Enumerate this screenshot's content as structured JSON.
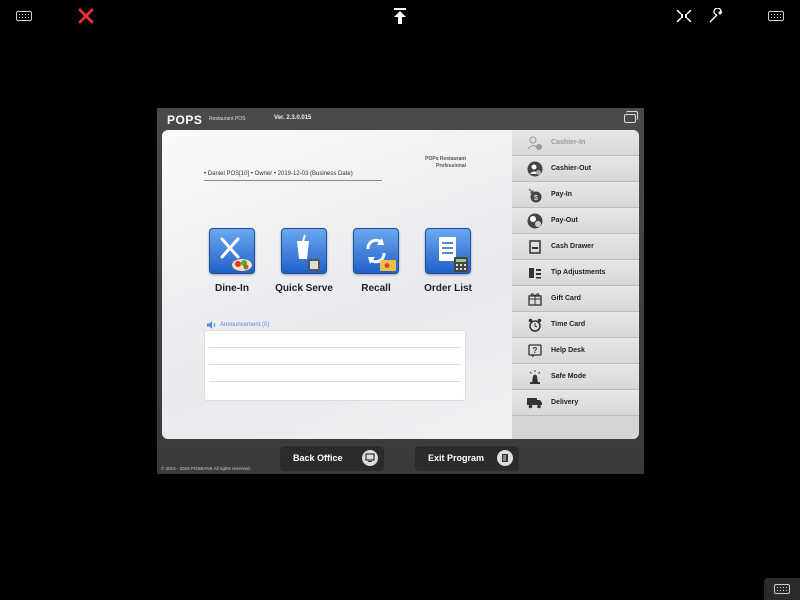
{
  "app": {
    "logo": "POPS",
    "logo_sub": "Restaurant POS",
    "version": "Ver. 2.3.0.015",
    "brand_line1": "POPs Restaurant",
    "brand_line2": "Professional",
    "user_info": "• Daniel POS[10]    • Owner    • 2019-12-03 (Business Date)"
  },
  "main_buttons": [
    {
      "label": "Dine-In",
      "icon": "dine-in-icon"
    },
    {
      "label": "Quick Serve",
      "icon": "quick-serve-icon"
    },
    {
      "label": "Recall",
      "icon": "recall-icon"
    },
    {
      "label": "Order List",
      "icon": "order-list-icon"
    }
  ],
  "announcement": {
    "label": "Announcement (0)"
  },
  "sidebar": {
    "items": [
      {
        "label": "Cashier-In",
        "icon": "cashier-in-icon",
        "disabled": true
      },
      {
        "label": "Cashier-Out",
        "icon": "cashier-out-icon"
      },
      {
        "label": "Pay-In",
        "icon": "pay-in-icon"
      },
      {
        "label": "Pay-Out",
        "icon": "pay-out-icon"
      },
      {
        "label": "Cash Drawer",
        "icon": "cash-drawer-icon"
      },
      {
        "label": "Tip Adjustments",
        "icon": "tip-adjustments-icon"
      },
      {
        "label": "Gift Card",
        "icon": "gift-card-icon"
      },
      {
        "label": "Time Card",
        "icon": "time-card-icon"
      },
      {
        "label": "Help Desk",
        "icon": "help-desk-icon"
      },
      {
        "label": "Safe Mode",
        "icon": "safe-mode-icon"
      },
      {
        "label": "Delivery",
        "icon": "delivery-icon"
      }
    ]
  },
  "bottom": {
    "back_office": "Back Office",
    "exit_program": "Exit Program",
    "copyright": "© 2013 - 2019 POSBANK All rights reserved."
  },
  "colors": {
    "close": "#e03030",
    "accent": "#2160c8"
  }
}
